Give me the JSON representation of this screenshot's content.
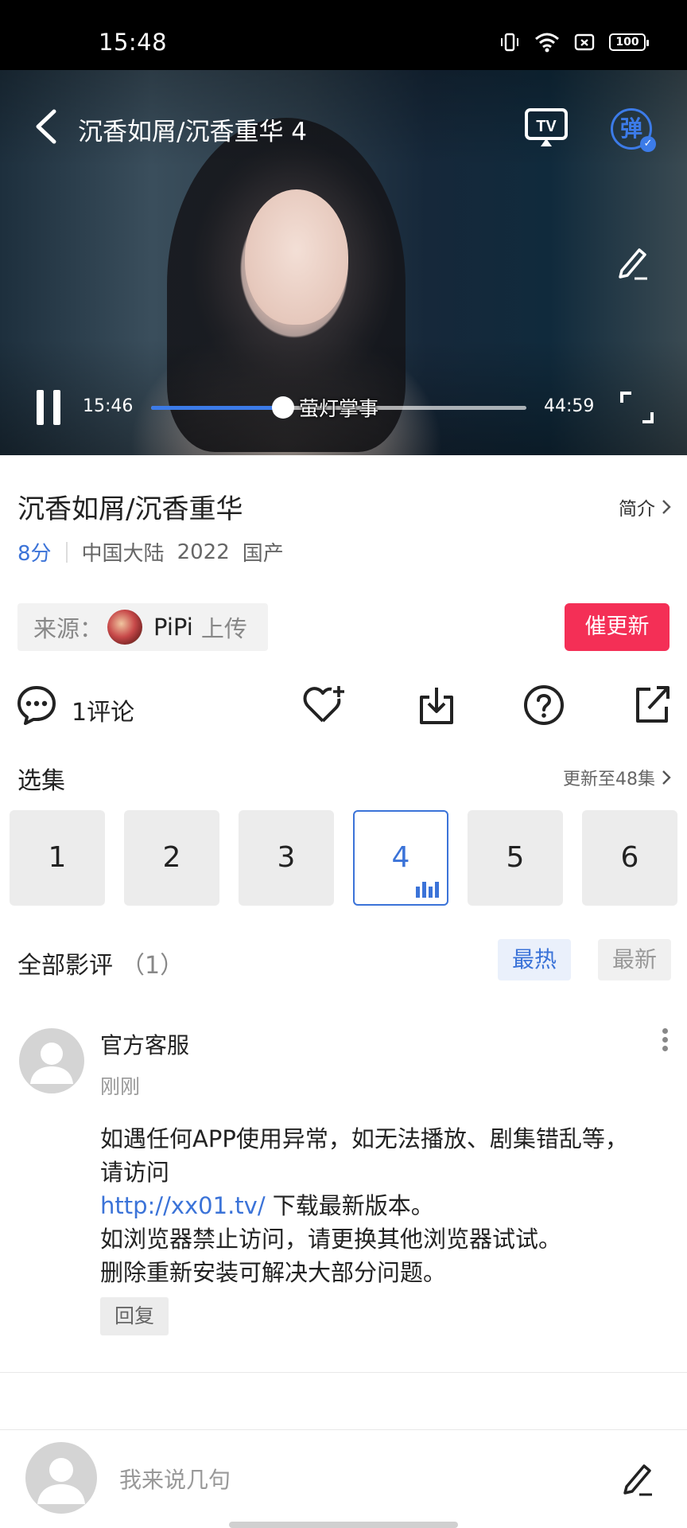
{
  "status_bar": {
    "time": "15:48",
    "battery": "100"
  },
  "player": {
    "title": "沉香如屑/沉香重华 4",
    "current_time": "15:46",
    "duration": "44:59",
    "progress_fraction": 0.351,
    "chapter_label": "萤灯掌事",
    "danmu_label": "弹",
    "tv_label": "TV"
  },
  "info": {
    "title": "沉香如屑/沉香重华",
    "intro_label": "简介",
    "score": "8分",
    "region": "中国大陆",
    "year": "2022",
    "category": "国产",
    "source_prefix": "来源：",
    "uploader": "PiPi",
    "upload_suffix": "上传",
    "urge_update": "催更新"
  },
  "actions": {
    "comments": "1评论"
  },
  "episodes": {
    "heading": "选集",
    "update_status": "更新至48集",
    "items": [
      "1",
      "2",
      "3",
      "4",
      "5",
      "6"
    ],
    "active_index": 3
  },
  "reviews": {
    "heading": "全部影评",
    "count": "（1）",
    "tab_hot": "最热",
    "tab_new": "最新",
    "comment": {
      "user": "官方客服",
      "time": "刚刚",
      "line1": "如遇任何APP使用异常，如无法播放、剧集错乱等，",
      "line2": "请访问",
      "link": "http://xx01.tv/",
      "line3_rest": " 下载最新版本。",
      "line4": "如浏览器禁止访问，请更换其他浏览器试试。",
      "line5": "删除重新安装可解决大部分问题。",
      "reply": "回复"
    }
  },
  "bottom_bar": {
    "placeholder": "我来说几句"
  },
  "colors": {
    "accent": "#3b73d8",
    "urge": "#f42f56"
  }
}
